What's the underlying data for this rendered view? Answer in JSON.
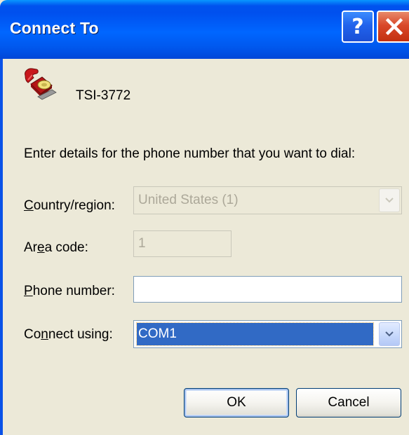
{
  "window": {
    "title": "Connect To",
    "help_glyph": "?",
    "controls": [
      "help-icon",
      "close-icon"
    ]
  },
  "connection": {
    "icon": "telephone-icon",
    "name": "TSI-3772"
  },
  "instruction": "Enter details for the phone number that you want to dial:",
  "form": {
    "country": {
      "label_pre": "",
      "label_accel": "C",
      "label_post": "ountry/region:",
      "value": "United States (1)",
      "enabled": false
    },
    "area_code": {
      "label_pre": "Ar",
      "label_accel": "e",
      "label_post": "a code:",
      "value": "1",
      "enabled": false
    },
    "phone": {
      "label_pre": "",
      "label_accel": "P",
      "label_post": "hone number:",
      "value": "",
      "enabled": true
    },
    "connect_using": {
      "label_pre": "Co",
      "label_accel": "n",
      "label_post": "nect using:",
      "value": "COM1",
      "enabled": true
    }
  },
  "buttons": {
    "ok": "OK",
    "cancel": "Cancel"
  },
  "colors": {
    "titlebar": "#0058ee",
    "dialog_bg": "#ece9d8",
    "selection": "#316ac5",
    "close_button": "#d9492a"
  }
}
